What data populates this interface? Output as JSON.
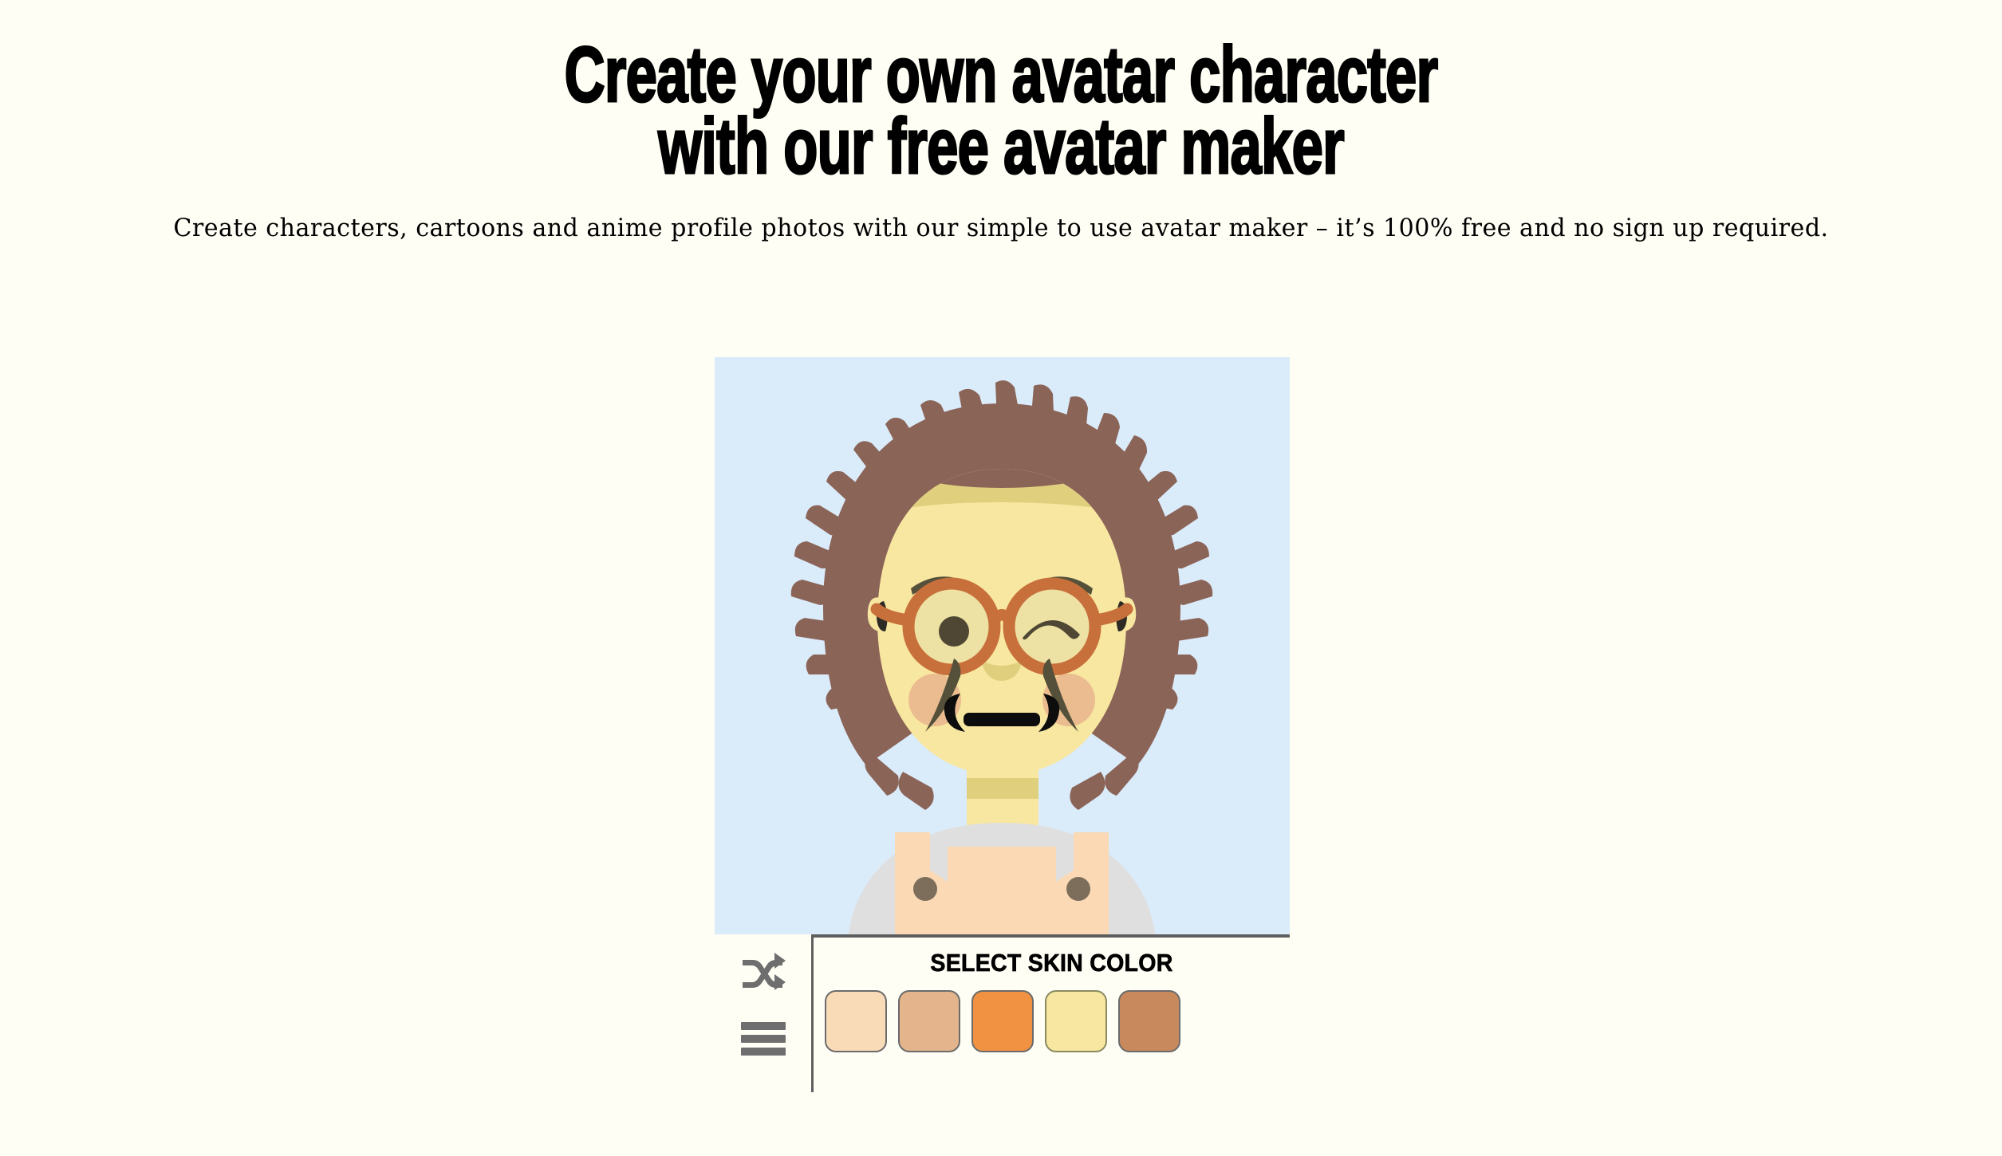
{
  "page": {
    "background_color": "#FFFEF5",
    "title_line1": "Create your own avatar character",
    "title_line2": "with our free avatar maker",
    "subtitle": "Create characters, cartoons and anime profile photos with our simple to use avatar maker – it’s 100% free and no sign up required."
  },
  "avatar": {
    "canvas_background": "#DAEBFA",
    "skin_color": "#F8E7A0",
    "skin_shadow": "#E0D07E",
    "hair_color": "#8B6458",
    "brow_color": "#55503A",
    "pupil_color": "#4F4733",
    "glasses_color": "#C8703C",
    "lens_color": "#EDE2A4",
    "blush_color": "#E8B48C",
    "shirt_color": "#DFDFDF",
    "overalls_color": "#FAD9B4",
    "button_color": "#7D6E5C",
    "features": {
      "hair_style": "afro-dreadlocks",
      "eye_left": "open-with-pupil",
      "eye_right": "winking",
      "mouth": "open-bracket-smile",
      "accessory": "round-glasses",
      "facial_hair": "goatee-strands",
      "outfit": "overalls-over-tee"
    }
  },
  "editor": {
    "tools": [
      {
        "name": "shuffle-icon",
        "label": "Randomize",
        "color": "#6E6E6E"
      },
      {
        "name": "menu-icon",
        "label": "Menu",
        "color": "#6E6E6E"
      }
    ],
    "picker": {
      "title": "SELECT SKIN COLOR",
      "selected_index": 3,
      "swatches": [
        {
          "label": "Light peach",
          "color": "#F9DBB8"
        },
        {
          "label": "Tan",
          "color": "#E4B48C"
        },
        {
          "label": "Orange",
          "color": "#F09242"
        },
        {
          "label": "Pale yellow",
          "color": "#F8E7A0"
        },
        {
          "label": "Medium brown",
          "color": "#C88A5C"
        }
      ]
    }
  }
}
